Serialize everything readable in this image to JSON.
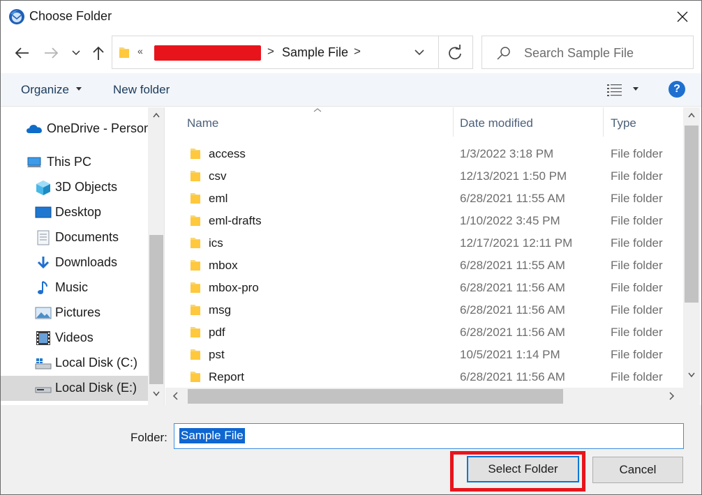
{
  "window": {
    "title": "Choose Folder",
    "close_label": "✕"
  },
  "address": {
    "overflow_chevron": "«",
    "separator": ">",
    "crumb": "Sample File",
    "redaction_color": "#e8141c"
  },
  "search": {
    "placeholder": "Search Sample File"
  },
  "toolbar": {
    "organize": "Organize",
    "new_folder": "New folder",
    "help": "?"
  },
  "nav": {
    "items": [
      {
        "label": "OneDrive - Person",
        "icon": "onedrive-cloud-icon"
      },
      {
        "label": "This PC",
        "icon": "computer-icon"
      },
      {
        "label": "3D Objects",
        "icon": "3d-objects-icon"
      },
      {
        "label": "Desktop",
        "icon": "desktop-icon"
      },
      {
        "label": "Documents",
        "icon": "documents-icon"
      },
      {
        "label": "Downloads",
        "icon": "downloads-icon"
      },
      {
        "label": "Music",
        "icon": "music-icon"
      },
      {
        "label": "Pictures",
        "icon": "pictures-icon"
      },
      {
        "label": "Videos",
        "icon": "videos-icon"
      },
      {
        "label": "Local Disk (C:)",
        "icon": "drive-icon"
      },
      {
        "label": "Local Disk (E:)",
        "icon": "drive-icon",
        "selected": true
      }
    ]
  },
  "columns": {
    "name": "Name",
    "date": "Date modified",
    "type": "Type"
  },
  "files": [
    {
      "name": "access",
      "date": "1/3/2022 3:18 PM",
      "type": "File folder"
    },
    {
      "name": "csv",
      "date": "12/13/2021 1:50 PM",
      "type": "File folder"
    },
    {
      "name": "eml",
      "date": "6/28/2021 11:55 AM",
      "type": "File folder"
    },
    {
      "name": "eml-drafts",
      "date": "1/10/2022 3:45 PM",
      "type": "File folder"
    },
    {
      "name": "ics",
      "date": "12/17/2021 12:11 PM",
      "type": "File folder"
    },
    {
      "name": "mbox",
      "date": "6/28/2021 11:55 AM",
      "type": "File folder"
    },
    {
      "name": "mbox-pro",
      "date": "6/28/2021 11:56 AM",
      "type": "File folder"
    },
    {
      "name": "msg",
      "date": "6/28/2021 11:56 AM",
      "type": "File folder"
    },
    {
      "name": "pdf",
      "date": "6/28/2021 11:56 AM",
      "type": "File folder"
    },
    {
      "name": "pst",
      "date": "10/5/2021 1:14 PM",
      "type": "File folder"
    },
    {
      "name": "Report",
      "date": "6/28/2021 11:56 AM",
      "type": "File folder"
    }
  ],
  "footer": {
    "folder_label": "Folder:",
    "folder_value": "Sample File",
    "select_button": "Select Folder",
    "cancel_button": "Cancel",
    "highlight_color": "#e8141c"
  }
}
